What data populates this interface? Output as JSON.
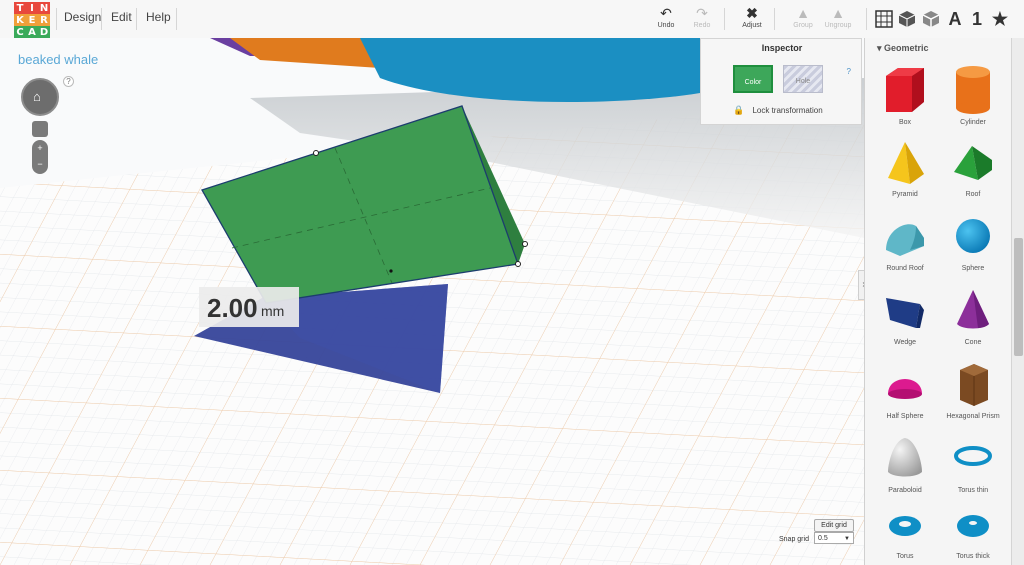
{
  "app": {
    "logo_letters": [
      "T",
      "I",
      "N",
      "K",
      "E",
      "R",
      "C",
      "A",
      "D"
    ],
    "logo_colors": [
      "#e8483d",
      "#e8483d",
      "#e8483d",
      "#f0a03a",
      "#f0a03a",
      "#f0a03a",
      "#3aaa5a",
      "#3aaa5a",
      "#3aaa5a"
    ]
  },
  "menu": {
    "items": [
      "Design",
      "Edit",
      "Help"
    ]
  },
  "toolbar": {
    "undo": "Undo",
    "redo": "Redo",
    "adjust": "Adjust",
    "group": "Group",
    "ungroup": "Ungroup",
    "views": [
      "grid-view-icon",
      "solid-cube-icon",
      "wireframe-cube-icon",
      "letter-a-icon",
      "number-one-icon",
      "star-icon"
    ]
  },
  "project": {
    "name": "beaked whale"
  },
  "viewport": {
    "dimension_value": "2.00",
    "dimension_unit": "mm",
    "help": "?"
  },
  "inspector": {
    "title": "Inspector",
    "color_label": "Color",
    "hole_label": "Hole",
    "help": "?",
    "lock_label": "Lock transformation",
    "selected_color": "#3da75a"
  },
  "sidebar": {
    "section": "Geometric",
    "shapes": [
      {
        "label": "Box"
      },
      {
        "label": "Cylinder"
      },
      {
        "label": "Pyramid"
      },
      {
        "label": "Roof"
      },
      {
        "label": "Round Roof"
      },
      {
        "label": "Sphere"
      },
      {
        "label": "Wedge"
      },
      {
        "label": "Cone"
      },
      {
        "label": "Half Sphere"
      },
      {
        "label": "Hexagonal Prism"
      },
      {
        "label": "Paraboloid"
      },
      {
        "label": "Torus thin"
      },
      {
        "label": "Torus"
      },
      {
        "label": "Torus thick"
      }
    ]
  },
  "grid": {
    "edit_label": "Edit grid",
    "snap_label": "Snap grid",
    "snap_value": "0.5"
  }
}
